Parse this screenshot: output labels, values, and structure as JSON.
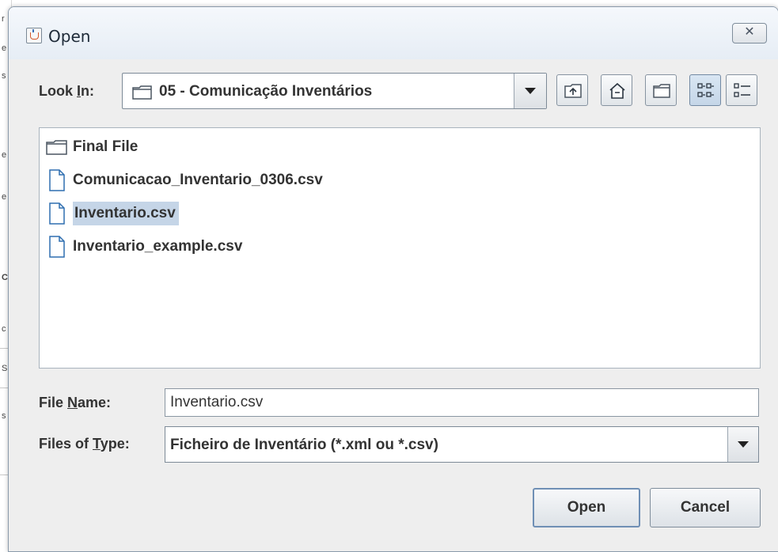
{
  "window": {
    "title": "Open",
    "close_icon": "close-icon",
    "app_icon": "java-cup-icon"
  },
  "look_in": {
    "label_prefix": "Look ",
    "label_mnemonic": "I",
    "label_suffix": "n:",
    "value": "05 - Comunicação Inventários"
  },
  "toolbar": {
    "buttons": [
      {
        "name": "up-one-level",
        "icon": "up-folder-icon"
      },
      {
        "name": "home",
        "icon": "home-icon"
      },
      {
        "name": "create-new-folder",
        "icon": "new-folder-icon"
      },
      {
        "name": "list-view",
        "icon": "list-view-icon",
        "selected": true
      },
      {
        "name": "details-view",
        "icon": "details-view-icon",
        "selected": false
      }
    ]
  },
  "files": [
    {
      "name": "Final File",
      "type": "folder",
      "selected": false
    },
    {
      "name": "Comunicacao_Inventario_0306.csv",
      "type": "file",
      "selected": false
    },
    {
      "name": "Inventario.csv",
      "type": "file",
      "selected": true
    },
    {
      "name": "Inventario_example.csv",
      "type": "file",
      "selected": false
    }
  ],
  "file_name": {
    "label_prefix": "File ",
    "label_mnemonic": "N",
    "label_suffix": "ame:",
    "value": "Inventario.csv"
  },
  "file_type": {
    "label_prefix": "Files of ",
    "label_mnemonic": "T",
    "label_suffix": "ype:",
    "value": "Ficheiro de Inventário (*.xml ou *.csv)"
  },
  "buttons": {
    "open": "Open",
    "cancel": "Cancel"
  },
  "colors": {
    "selection": "#c5d5e7",
    "dialog_bg": "#eeeeee"
  }
}
